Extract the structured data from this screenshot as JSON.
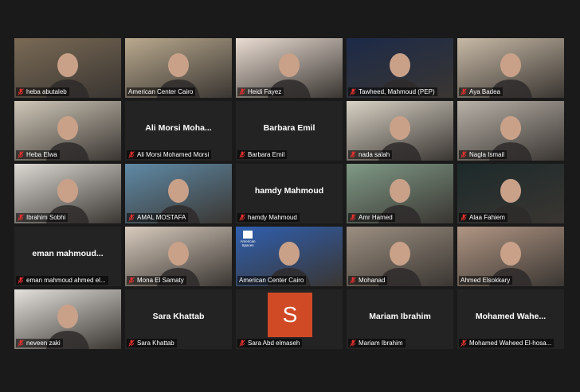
{
  "meeting": {
    "participants": [
      {
        "name": "heba abutaleb",
        "muted": true,
        "video": true,
        "bg": "#7a6a55"
      },
      {
        "name": "American Center Cairo",
        "muted": false,
        "video": true,
        "active": true,
        "bg": "#b9a98e"
      },
      {
        "name": "Heidi Fayez",
        "muted": true,
        "video": true,
        "bg": "#e9dcd2"
      },
      {
        "name": "Tawheed, Mahmoud (PEP)",
        "muted": true,
        "video": true,
        "bg": "#1c2a48"
      },
      {
        "name": "Aya Badea",
        "muted": true,
        "video": true,
        "bg": "#c7b9a6"
      },
      {
        "name": "Heba Elwa",
        "muted": true,
        "video": true,
        "bg": "#cfc7b8"
      },
      {
        "name": "Ali Morsi Mohamed Morsi",
        "display": "Ali  Morsi  Moha...",
        "muted": true,
        "video": false
      },
      {
        "name": "Barbara Emil",
        "display": "Barbara Emil",
        "muted": true,
        "video": false
      },
      {
        "name": "nada salah",
        "muted": true,
        "video": true,
        "bg": "#d8d2c5"
      },
      {
        "name": "Nagla Ismail",
        "muted": true,
        "video": true,
        "bg": "#b8b1a8"
      },
      {
        "name": "Ibrahim Sobhi",
        "muted": true,
        "video": true,
        "bg": "#dcd8d2"
      },
      {
        "name": "AMAL MOSTAFA",
        "muted": true,
        "video": true,
        "bg": "#5f8aa6"
      },
      {
        "name": "hamdy Mahmoud",
        "display": "hamdy Mahmoud",
        "muted": true,
        "video": false
      },
      {
        "name": "Amr Hamed",
        "muted": true,
        "video": true,
        "bg": "#7f9a86"
      },
      {
        "name": "Alaa Fahiem",
        "muted": true,
        "video": true,
        "bg": "#1c2a2a"
      },
      {
        "name": "eman mahmoud ahmed el...",
        "display": "eman  mahmoud...",
        "muted": true,
        "video": false
      },
      {
        "name": "Mona El Samaty",
        "muted": true,
        "video": true,
        "bg": "#d8cbbd"
      },
      {
        "name": "American Center Cairo",
        "muted": false,
        "video": true,
        "bg": "#2f5fb0",
        "logo": "American Spaces"
      },
      {
        "name": "Mohanad",
        "muted": true,
        "video": true,
        "bg": "#9c8f81"
      },
      {
        "name": "Ahmed Elsokkary",
        "muted": false,
        "video": true,
        "bg": "#b09583"
      },
      {
        "name": "neveen zaki",
        "muted": true,
        "video": true,
        "bg": "#e4e1dc"
      },
      {
        "name": "Sara Khattab",
        "display": "Sara Khattab",
        "muted": true,
        "video": false
      },
      {
        "name": "Sara Abd elmaseh",
        "avatar": "S",
        "muted": true,
        "video": false
      },
      {
        "name": "Mariam Ibrahim",
        "display": "Mariam Ibrahim",
        "muted": true,
        "video": false
      },
      {
        "name": "Mohamed Waheed El-hosa...",
        "display": "Mohamed  Wahe...",
        "muted": true,
        "video": false
      }
    ]
  },
  "colors": {
    "background": "#1a1a1a",
    "tile": "#232323",
    "active_speaker_border": "#c8e63a",
    "muted_icon": "#e0312f"
  }
}
